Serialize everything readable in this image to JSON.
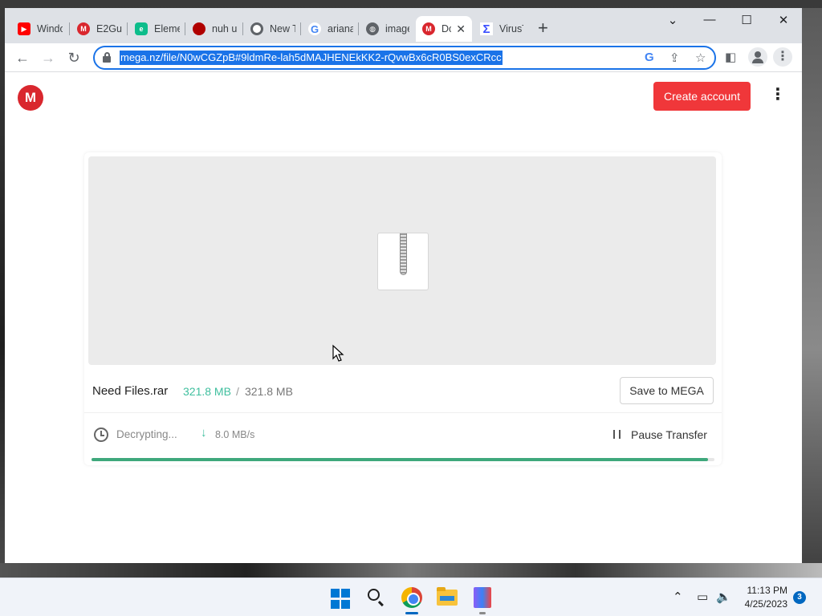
{
  "browser": {
    "tabs": [
      {
        "label": "Windo",
        "favicon": "youtube-icon",
        "color": "#ff0000"
      },
      {
        "label": "E2Gua",
        "favicon": "mega-icon",
        "color": "#d9272e"
      },
      {
        "label": "Eleme",
        "favicon": "element-icon",
        "color": "#0dbd8b"
      },
      {
        "label": "nuh u",
        "favicon": "red-circle-icon",
        "color": "#b00000"
      },
      {
        "label": "New T",
        "favicon": "chrome-icon",
        "color": "#5f6368"
      },
      {
        "label": "ariana",
        "favicon": "google-icon",
        "color": "#4285f4"
      },
      {
        "label": "image",
        "favicon": "globe-icon",
        "color": "#5f6368"
      },
      {
        "label": "Do",
        "favicon": "mega-icon",
        "color": "#d9272e",
        "active": true
      },
      {
        "label": "VirusT",
        "favicon": "virustotal-icon",
        "color": "#394eff"
      }
    ],
    "new_tab": "+",
    "url": "mega.nz/file/N0wCGZpB#9ldmRe-lah5dMAJHENEkKK2-rQvwBx6cR0BS0exCRcc"
  },
  "mega": {
    "logo_letter": "M",
    "create_account": "Create account",
    "file_name": "Need Files.rar",
    "size_done": "321.8 MB",
    "size_sep": "/",
    "size_total": "321.8 MB",
    "save_label": "Save to MEGA",
    "status": "Decrypting...",
    "speed": "8.0 MB/s",
    "pause_label": "Pause Transfer",
    "progress": 0.99,
    "accent": "#f0373a",
    "progress_color": "#3fa87c"
  },
  "taskbar": {
    "time": "11:13 PM",
    "date": "4/25/2023",
    "notifications": "3"
  }
}
